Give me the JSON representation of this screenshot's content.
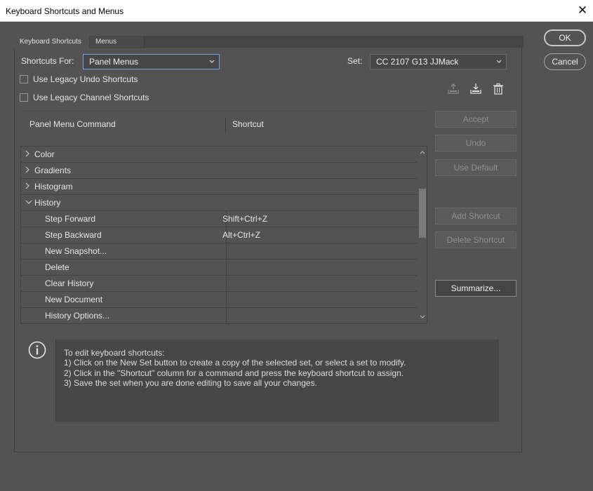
{
  "window": {
    "title": "Keyboard Shortcuts and Menus",
    "close_glyph": "✕"
  },
  "tabs": [
    {
      "label": "Keyboard Shortcuts",
      "active": true
    },
    {
      "label": "Menus",
      "active": false
    }
  ],
  "shortcuts_for": {
    "label": "Shortcuts For:",
    "value": "Panel Menus"
  },
  "set": {
    "label": "Set:",
    "value": "CC 2107 G13 JJMack"
  },
  "checkboxes": [
    {
      "label": "Use Legacy Undo Shortcuts",
      "checked": false
    },
    {
      "label": "Use Legacy Channel Shortcuts",
      "checked": false
    }
  ],
  "icons": [
    "save-set-icon",
    "new-set-icon",
    "delete-set-icon"
  ],
  "table": {
    "col_command": "Panel Menu Command",
    "col_shortcut": "Shortcut",
    "groups": [
      {
        "label": "Color",
        "expanded": false
      },
      {
        "label": "Gradients",
        "expanded": false
      },
      {
        "label": "Histogram",
        "expanded": false
      },
      {
        "label": "History",
        "expanded": true
      }
    ],
    "items": [
      {
        "command": "Step Forward",
        "shortcut": "Shift+Ctrl+Z"
      },
      {
        "command": "Step Backward",
        "shortcut": "Alt+Ctrl+Z"
      },
      {
        "command": "New Snapshot...",
        "shortcut": ""
      },
      {
        "command": "Delete",
        "shortcut": ""
      },
      {
        "command": "Clear History",
        "shortcut": ""
      },
      {
        "command": "New Document",
        "shortcut": ""
      },
      {
        "command": "History Options...",
        "shortcut": ""
      }
    ]
  },
  "side_buttons": {
    "accept": "Accept",
    "undo": "Undo",
    "use_default": "Use Default",
    "add_shortcut": "Add Shortcut",
    "delete_shortcut": "Delete Shortcut",
    "summarize": "Summarize..."
  },
  "dialog_buttons": {
    "ok": "OK",
    "cancel": "Cancel"
  },
  "info": {
    "lines": [
      "To edit keyboard shortcuts:",
      "1) Click on the New Set button to create a copy of the selected set, or select a set to modify.",
      "2) Click in the \"Shortcut\" column for a command and press the keyboard shortcut to assign.",
      "3) Save the set when you are done editing to save all your changes."
    ]
  }
}
